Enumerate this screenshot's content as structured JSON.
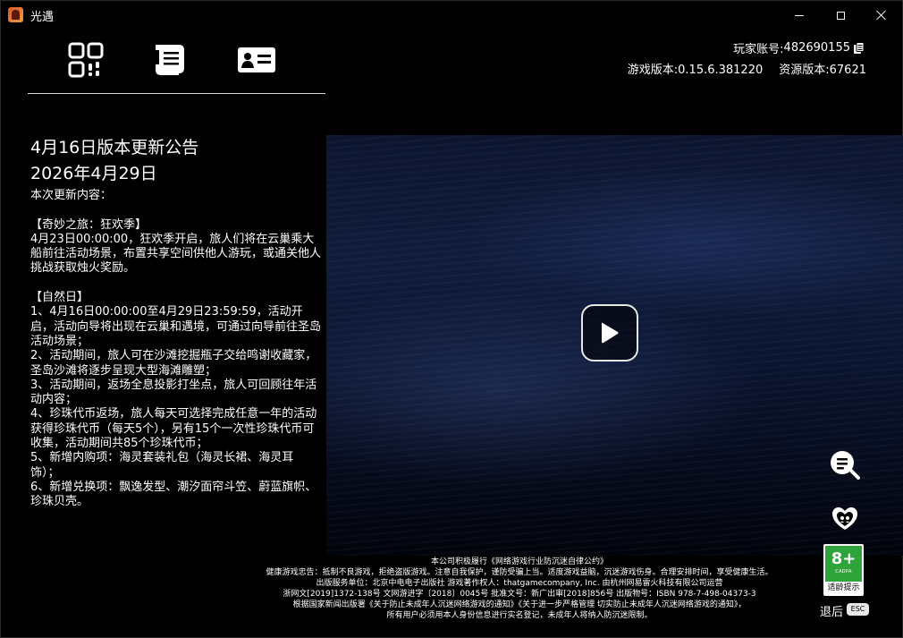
{
  "window": {
    "title": "光遇",
    "controls": [
      "minimize",
      "maximize",
      "close"
    ]
  },
  "nav": {
    "icons": [
      "qr-code-icon",
      "notice-scroll-icon",
      "id-card-icon"
    ]
  },
  "account": {
    "label": "玩家账号:",
    "id": "482690155"
  },
  "version": {
    "game_label": "游戏版本:",
    "game_value": "0.15.6.381220",
    "resource_label": "资源版本:",
    "resource_value": "67621"
  },
  "announcement": {
    "title": "4月16日版本更新公告",
    "date": "2026年4月29日",
    "body": "本次更新内容：\n\n【奇妙之旅：狂欢季】\n4月23日00:00:00，狂欢季开启，旅人们将在云巢乘大船前往活动场景，布置共享空间供他人游玩，或通关他人挑战获取烛火奖励。\n\n【自然日】\n1、4月16日00:00:00至4月29日23:59:59，活动开启，活动向导将出现在云巢和遇境，可通过向导前往圣岛活动场景；\n2、活动期间，旅人可在沙滩挖掘瓶子交给鸣谢收藏家，圣岛沙滩将逐步呈现大型海滩雕塑；\n3、活动期间，返场全息投影打坐点，旅人可回顾往年活动内容；\n4、珍珠代币返场，旅人每天可选择完成任意一年的活动获得珍珠代币（每天5个），另有15个一次性珍珠代币可收集，活动期间共85个珍珠代币；\n5、新增内购项：海灵套装礼包（海灵长裙、海灵耳饰）；\n6、新增兑换项：飘逸发型、潮汐面帘斗笠、蔚蓝旗帜、珍珠贝壳。"
  },
  "video": {
    "play_icon": "play-icon"
  },
  "side_buttons": {
    "search_icon": "chat-search-icon",
    "guard_icon": "parental-guard-icon"
  },
  "age_rating": {
    "age": "8+",
    "org": "CADPA",
    "label": "适龄提示"
  },
  "exit": {
    "label": "退后",
    "key": "ESC"
  },
  "legal": {
    "line1": "本公司积极履行《网络游戏行业防沉迷自律公约》",
    "line2": "健康游戏忠告：抵制不良游戏，拒绝盗版游戏。注意自我保护，谨防受骗上当。适度游戏益脑，沉迷游戏伤身。合理安排时间，享受健康生活。",
    "line3": "出版服务单位：北京中电电子出版社 游戏著作权人：thatgamecompany, Inc. 由杭州网易雷火科技有限公司运营",
    "line4": "浙网文[2019]1372-138号  文网游进字〔2018〕0045号  批准文号：新广出审[2018]856号  出版物号：ISBN 978-7-498-04373-3",
    "line5": "根据国家新闻出版署《关于防止未成年人沉迷网络游戏的通知》《关于进一步严格管理 切实防止未成年人沉迷网络游戏的通知》，",
    "line6": "所有用户必须用本人身份信息进行实名登记，未成年人将纳入防沉迷限制。"
  }
}
